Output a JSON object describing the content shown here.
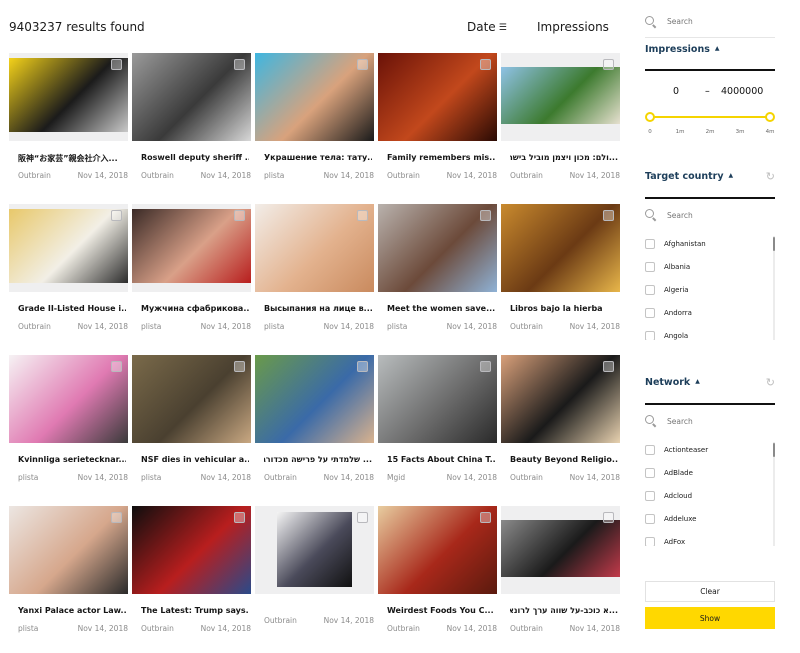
{
  "header": {
    "results_count": "9403237 results found",
    "sort_date_label": "Date",
    "sort_date_icon": "sort-descending-icon",
    "sort_impressions_label": "Impressions"
  },
  "cards": [
    {
      "title": "阪神“お家芸”親会社介入...",
      "network": "Outbrain",
      "date": "Nov 14, 2018",
      "rtl": false,
      "image": "man covering face before yellow-black tiger flag",
      "colors": [
        "#f4d21a",
        "#1b1b1b",
        "#c9c9c9"
      ]
    },
    {
      "title": "Roswell deputy sheriff ...",
      "network": "Outbrain",
      "date": "Nov 14, 2018",
      "rtl": false,
      "image": "black and white alien head sculpture",
      "colors": [
        "#9a9a9a",
        "#3a3a3a",
        "#d8d8d8"
      ]
    },
    {
      "title": "Украшение тела: тату...",
      "network": "plista",
      "date": "Nov 14, 2018",
      "rtl": false,
      "image": "tattooed woman on beach",
      "colors": [
        "#3fb6e0",
        "#d9a27c",
        "#1a1a1a"
      ]
    },
    {
      "title": "Family remembers mis...",
      "network": "Outbrain",
      "date": "Nov 14, 2018",
      "rtl": false,
      "image": "two framed portraits on red background",
      "colors": [
        "#6a1208",
        "#c2481c",
        "#2a0a04"
      ]
    },
    {
      "title": "...ולם: מכון ויצמן מוביל בישראל",
      "network": "Outbrain",
      "date": "Nov 14, 2018",
      "rtl": true,
      "image": "university building with lawn",
      "colors": [
        "#8fc2e6",
        "#3c7a2e",
        "#e6e0cf"
      ]
    },
    {
      "title": "Grade II-Listed House i...",
      "network": "Outbrain",
      "date": "Nov 14, 2018",
      "rtl": false,
      "image": "yellow terraced houses",
      "colors": [
        "#e8c86a",
        "#f2efe6",
        "#2c2c2c"
      ]
    },
    {
      "title": "Мужчина сфабрикова...",
      "network": "plista",
      "date": "Nov 14, 2018",
      "rtl": false,
      "image": "man with glasses and beard",
      "colors": [
        "#3a2a26",
        "#d9a088",
        "#b81e1e"
      ]
    },
    {
      "title": "Высыпания на лице в...",
      "network": "plista",
      "date": "Nov 14, 2018",
      "rtl": false,
      "image": "woman touching her face",
      "colors": [
        "#f2ede8",
        "#e3b28e",
        "#c98a5e"
      ]
    },
    {
      "title": "Meet the women save...",
      "network": "plista",
      "date": "Nov 14, 2018",
      "rtl": false,
      "image": "two women posing",
      "colors": [
        "#b9b2ad",
        "#6c4a3a",
        "#8fb2d6"
      ]
    },
    {
      "title": "Libros bajo la hierba",
      "network": "Outbrain",
      "date": "Nov 14, 2018",
      "rtl": false,
      "image": "library hall with people",
      "colors": [
        "#c98a2e",
        "#6b3a14",
        "#e8b64a"
      ]
    },
    {
      "title": "Kvinnliga serietecknar...",
      "network": "plista",
      "date": "Nov 14, 2018",
      "rtl": false,
      "image": "comic illustration of riders on horses",
      "colors": [
        "#f6f2f4",
        "#e07ab2",
        "#3a3a3a"
      ]
    },
    {
      "title": "NSF dies in vehicular a...",
      "network": "plista",
      "date": "Nov 14, 2018",
      "rtl": false,
      "image": "military armoured vehicle",
      "colors": [
        "#7a6a4a",
        "#4a4030",
        "#c9a882"
      ]
    },
    {
      "title": "... שלמדתי על פרישה מכדורגל",
      "network": "Outbrain",
      "date": "Nov 14, 2018",
      "rtl": true,
      "image": "man holding football outdoors",
      "colors": [
        "#6a9a4a",
        "#3a6aa8",
        "#d9b28e"
      ]
    },
    {
      "title": "15 Facts About China T...",
      "network": "Mgid",
      "date": "Nov 14, 2018",
      "rtl": false,
      "image": "woman wearing mask in smog",
      "colors": [
        "#b8bcbd",
        "#6c6c6c",
        "#2a2a2a"
      ]
    },
    {
      "title": "Beauty Beyond Religio...",
      "network": "Outbrain",
      "date": "Nov 14, 2018",
      "rtl": false,
      "image": "beauty pageant contestants",
      "colors": [
        "#d9a07a",
        "#1a1a1a",
        "#e8d2b0"
      ]
    },
    {
      "title": "Yanxi Palace actor Law...",
      "network": "plista",
      "date": "Nov 14, 2018",
      "rtl": false,
      "image": "smiling actor portrait",
      "colors": [
        "#ece6e2",
        "#d6a78c",
        "#2a2a2a"
      ]
    },
    {
      "title": "The Latest: Trump says...",
      "network": "Outbrain",
      "date": "Nov 14, 2018",
      "rtl": false,
      "image": "rally stage with flags",
      "colors": [
        "#0e0e0e",
        "#b81e1e",
        "#2a4a8a"
      ]
    },
    {
      "title": "",
      "network": "Outbrain",
      "date": "Nov 14, 2018",
      "rtl": false,
      "image": "clothing collage",
      "colors": [
        "#f4f4f4",
        "#4a4a5a",
        "#111111"
      ]
    },
    {
      "title": "Weirdest Foods You C...",
      "network": "Outbrain",
      "date": "Nov 14, 2018",
      "rtl": false,
      "image": "pulled meat sandwich",
      "colors": [
        "#e8cda0",
        "#a8281a",
        "#5a1a0e"
      ]
    },
    {
      "title": "...א כוכב-על שווה ערך לרונאלדו",
      "network": "Outbrain",
      "date": "Nov 14, 2018",
      "rtl": true,
      "image": "three people posing indoors",
      "colors": [
        "#8a8a8a",
        "#1a1a1a",
        "#c23a4a"
      ]
    }
  ],
  "sidebar": {
    "search_placeholder": "Search",
    "impressions": {
      "title": "Impressions",
      "min_value": "0",
      "dash": "–",
      "max_value": "4000000",
      "slider_low_fraction": 0,
      "slider_high_fraction": 1,
      "ticks": [
        "0",
        "1m",
        "2m",
        "3m",
        "4m"
      ]
    },
    "target_country": {
      "title": "Target country",
      "search_placeholder": "Search",
      "items": [
        "Afghanistan",
        "Albania",
        "Algeria",
        "Andorra",
        "Angola"
      ]
    },
    "network": {
      "title": "Network",
      "search_placeholder": "Search",
      "items": [
        "Actionteaser",
        "AdBlade",
        "Adcloud",
        "Addeluxe",
        "AdFox"
      ]
    },
    "clear_label": "Clear",
    "show_label": "Show",
    "accent_color": "#ffd800",
    "heading_color": "#1d3e5a"
  }
}
